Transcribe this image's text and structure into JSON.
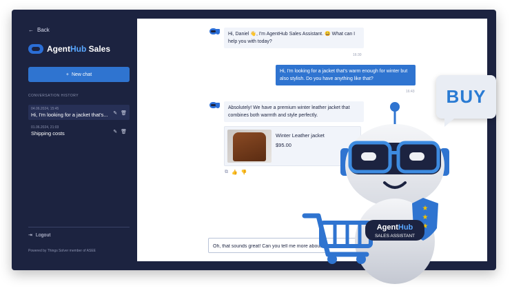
{
  "sidebar": {
    "back_label": "Back",
    "brand_prefix": "Agent",
    "brand_accent": "Hub",
    "brand_suffix": " Sales",
    "new_chat_label": "New chat",
    "history_title": "CONVERSATION HISTORY",
    "conversations": [
      {
        "date": "04.06.2024, 15:45",
        "title": "Hi, I'm looking for a jacket that's..."
      },
      {
        "date": "01.06.2024, 21:03",
        "title": "Shipping costs"
      }
    ],
    "logout_label": "Logout",
    "powered_by": "Powered by Things Solver member of ASEE"
  },
  "chat": {
    "messages": [
      {
        "role": "bot",
        "text": "Hi, Daniel 👋, I'm AgentHub Sales Assistant. 😀 What can I help you with today?",
        "time": "16:30"
      },
      {
        "role": "user",
        "text": "Hi, I'm looking for a jacket that's warm enough for winter but also stylish. Do you have anything like that?",
        "time": "16:43"
      },
      {
        "role": "bot",
        "text": "Absolutely! We have a premium winter leather jacket that combines both warmth and style perfectly."
      }
    ],
    "product": {
      "name": "Winter Leather jacket",
      "price": "$95.00"
    },
    "input_value": "Oh, that sounds great! Can you tell me more about"
  },
  "promo": {
    "buy_label": "BUY",
    "robot_badge_name_prefix": "Agent",
    "robot_badge_name_accent": "Hub",
    "robot_badge_sub": "SALES ASSISTANT"
  },
  "colors": {
    "sidebar_bg": "#1c2340",
    "accent": "#2f74d0",
    "bot_bubble": "#f1f4fa",
    "buy_text": "#2a7bd3"
  }
}
